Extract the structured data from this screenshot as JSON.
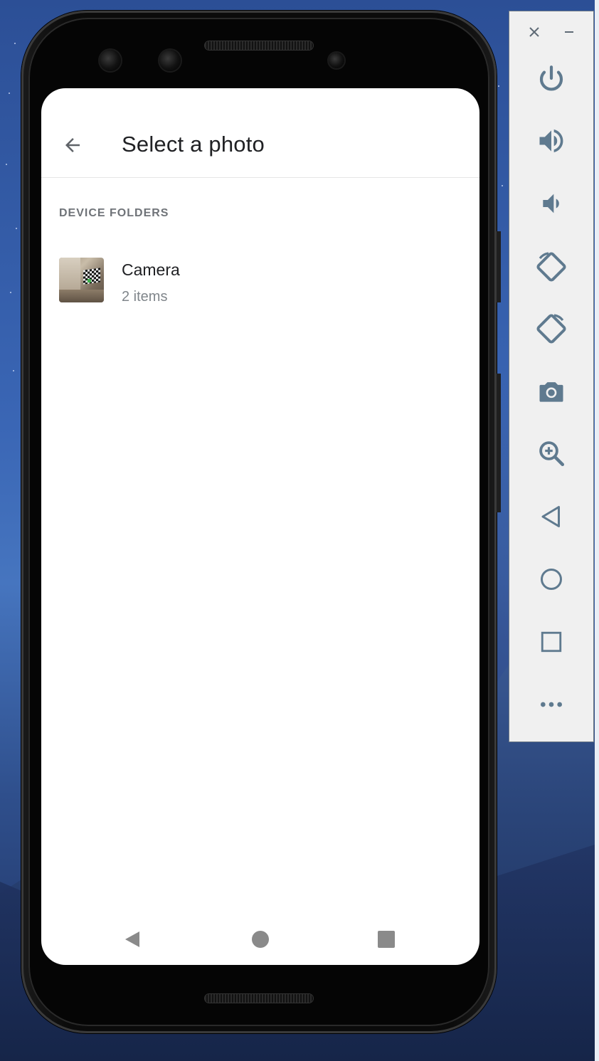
{
  "app": {
    "title": "Select a photo",
    "back_icon": "arrow-left-icon"
  },
  "folders": {
    "section_header": "DEVICE FOLDERS",
    "items": [
      {
        "name": "Camera",
        "count": "2 items"
      }
    ]
  },
  "system_nav": {
    "back": "back-triangle-icon",
    "home": "home-circle-icon",
    "recents": "recents-square-icon"
  },
  "emulator_panel": {
    "window_controls": [
      "close-icon",
      "minimize-icon"
    ],
    "tools": [
      "power-icon",
      "volume-up-icon",
      "volume-down-icon",
      "rotate-left-icon",
      "rotate-right-icon",
      "camera-icon",
      "zoom-icon",
      "back-icon",
      "home-icon",
      "overview-icon",
      "more-icon"
    ]
  },
  "colors": {
    "accent_icon": "#5f7a8f",
    "title_text": "#202124",
    "secondary_text": "#80868b"
  }
}
